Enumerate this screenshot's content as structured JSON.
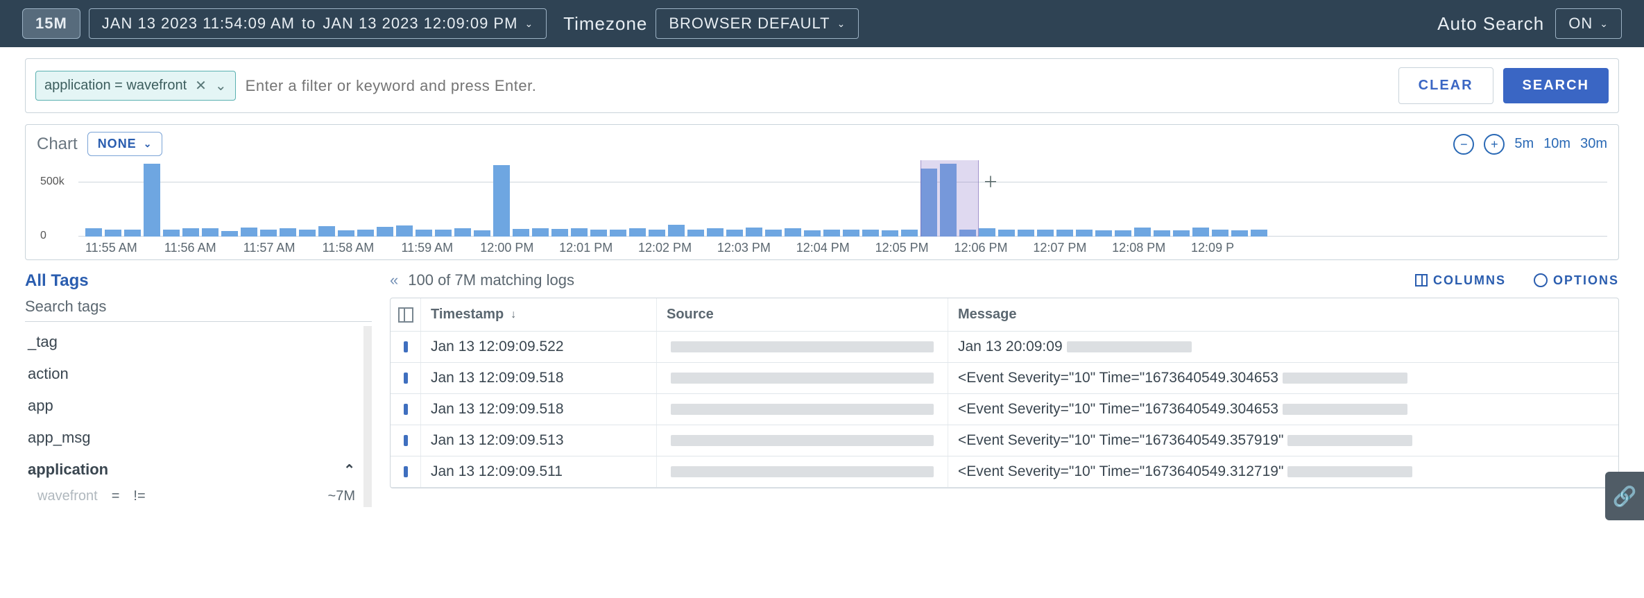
{
  "topbar": {
    "duration": "15M",
    "range_from": "JAN 13 2023 11:54:09 AM",
    "range_sep": "to",
    "range_to": "JAN 13 2023 12:09:09 PM",
    "timezone_label": "Timezone",
    "timezone_value": "BROWSER DEFAULT",
    "auto_search_label": "Auto Search",
    "auto_search_value": "ON"
  },
  "search": {
    "tag_text": "application = wavefront",
    "placeholder": "Enter a filter or keyword and press Enter.",
    "clear": "CLEAR",
    "search": "SEARCH"
  },
  "chart_ui": {
    "title": "Chart",
    "group_by": "NONE",
    "zoom": {
      "z5": "5m",
      "z10": "10m",
      "z30": "30m"
    }
  },
  "chart_data": {
    "type": "bar",
    "ylabel": "",
    "ylim": [
      0,
      650000
    ],
    "yticks": [
      0,
      500000
    ],
    "ytick_labels": [
      "0",
      "500k"
    ],
    "categories_major": [
      "11:55 AM",
      "11:56 AM",
      "11:57 AM",
      "11:58 AM",
      "11:59 AM",
      "12:00 PM",
      "12:01 PM",
      "12:02 PM",
      "12:03 PM",
      "12:04 PM",
      "12:05 PM",
      "12:06 PM",
      "12:07 PM",
      "12:08 PM",
      "12:09 P"
    ],
    "values": [
      70000,
      60000,
      60000,
      620000,
      60000,
      70000,
      70000,
      50000,
      80000,
      60000,
      70000,
      60000,
      90000,
      55000,
      60000,
      85000,
      95000,
      60000,
      60000,
      70000,
      55000,
      610000,
      65000,
      70000,
      65000,
      70000,
      60000,
      60000,
      70000,
      60000,
      100000,
      60000,
      70000,
      60000,
      80000,
      60000,
      70000,
      55000,
      60000,
      60000,
      60000,
      55000,
      60000,
      580000,
      620000,
      60000,
      70000,
      60000,
      60000,
      60000,
      60000,
      60000,
      55000,
      55000,
      80000,
      55000,
      55000,
      75000,
      60000,
      55000,
      60000
    ],
    "brush": {
      "start_index": 43,
      "end_index": 45
    }
  },
  "sidebar": {
    "all_tags": "All Tags",
    "search_tags": "Search tags",
    "items": [
      {
        "label": "_tag"
      },
      {
        "label": "action"
      },
      {
        "label": "app"
      },
      {
        "label": "app_msg"
      },
      {
        "label": "application",
        "expanded": true,
        "sub": {
          "value": "wavefront",
          "op_eq": "=",
          "op_ne": "!=",
          "count": "~7M"
        }
      }
    ]
  },
  "results": {
    "match_text": "100 of 7M matching logs",
    "columns_label": "COLUMNS",
    "options_label": "OPTIONS",
    "headers": {
      "ts": "Timestamp",
      "src": "Source",
      "msg": "Message"
    },
    "rows": [
      {
        "ts": "Jan 13 12:09:09.522",
        "src_redacted": true,
        "msg": "Jan 13 20:09:09",
        "msg_tail_redacted": true
      },
      {
        "ts": "Jan 13 12:09:09.518",
        "src_redacted": true,
        "msg": "<Event Severity=\"10\" Time=\"1673640549.304653",
        "msg_tail_redacted": true
      },
      {
        "ts": "Jan 13 12:09:09.518",
        "src_redacted": true,
        "msg": "<Event Severity=\"10\" Time=\"1673640549.304653",
        "msg_tail_redacted": true
      },
      {
        "ts": "Jan 13 12:09:09.513",
        "src_redacted": true,
        "msg": "<Event Severity=\"10\" Time=\"1673640549.357919\"",
        "msg_tail_redacted": true
      },
      {
        "ts": "Jan 13 12:09:09.511",
        "src_redacted": true,
        "msg": "<Event Severity=\"10\" Time=\"1673640549.312719\"",
        "msg_tail_redacted": true
      }
    ]
  }
}
